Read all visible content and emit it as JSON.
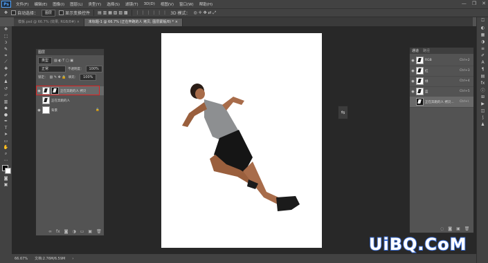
{
  "app": {
    "logo": "Ps"
  },
  "menu": [
    "文件(F)",
    "编辑(E)",
    "图像(I)",
    "图层(L)",
    "类型(Y)",
    "选择(S)",
    "滤镜(T)",
    "3D(D)",
    "视图(V)",
    "窗口(W)",
    "帮助(H)"
  ],
  "window_controls": [
    "—",
    "❐",
    "✕"
  ],
  "options_bar": {
    "auto_select_label": "自动选择：",
    "auto_select_value": "图层",
    "show_transform_label": "显示变换控件",
    "mode_3d_label": "3D 模式："
  },
  "tabs": [
    {
      "label": "模板.psd @ 66.7% (效果, RGB/8#) × "
    },
    {
      "label": "未标题-1 @ 66.7% (正在奔跑的人 拷贝, 图层蒙版/8) * × "
    }
  ],
  "status": {
    "zoom": "66.67%",
    "doc_size": "文档:2.76M/6.59M"
  },
  "layers_panel": {
    "title": "图层",
    "filter": "类型",
    "blend_mode": "正常",
    "opacity_label": "不透明度：",
    "opacity_value": "100%",
    "lock_label": "锁定：",
    "fill_label": "填充：",
    "fill_value": "100%",
    "layers": [
      {
        "name": "正在奔跑的人 拷贝",
        "visible": true,
        "selected": true
      },
      {
        "name": "正在奔跑的人",
        "visible": false,
        "selected": false
      },
      {
        "name": "背景",
        "visible": true,
        "selected": false
      }
    ]
  },
  "channels_panel": {
    "tabs": [
      "通道",
      "路径"
    ],
    "channels": [
      {
        "name": "RGB",
        "shortcut": "Ctrl+2"
      },
      {
        "name": "红",
        "shortcut": "Ctrl+3"
      },
      {
        "name": "绿",
        "shortcut": "Ctrl+4"
      },
      {
        "name": "蓝",
        "shortcut": "Ctrl+5"
      },
      {
        "name": "正在奔跑的人 拷贝...",
        "shortcut": "Ctrl+\\"
      }
    ]
  },
  "watermark": "UiBQ.CoM",
  "colors": {
    "accent": "#3a6ed8",
    "highlight": "#dd2222"
  }
}
